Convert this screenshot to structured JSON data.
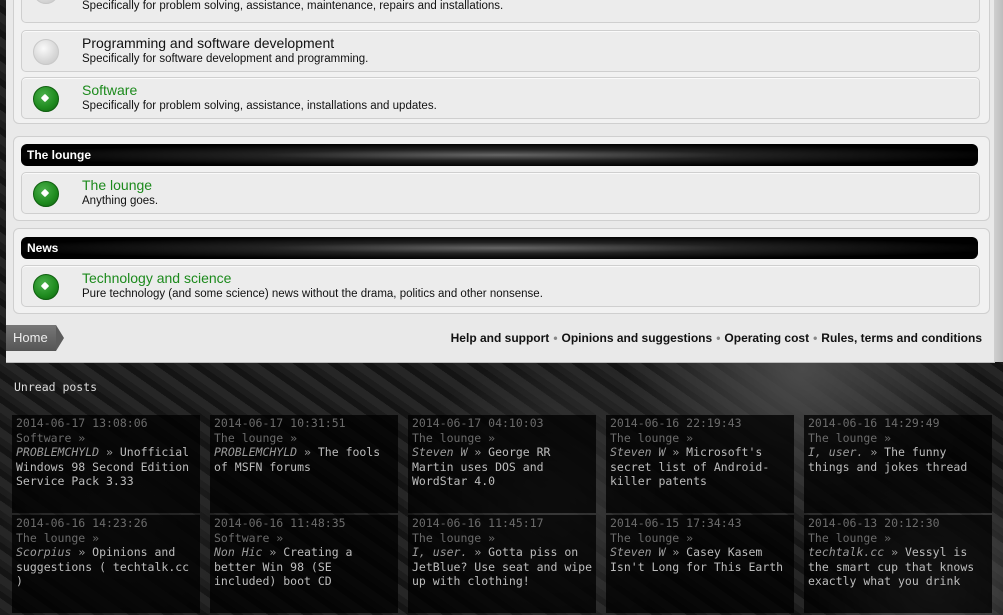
{
  "categories": {
    "support_forums": [
      {
        "name": "",
        "desc": "Specifically for problem solving, assistance, maintenance, repairs and installations.",
        "unread": false
      },
      {
        "name": "Programming and software development",
        "desc": "Specifically for software development and programming.",
        "unread": false
      },
      {
        "name": "Software",
        "desc": "Specifically for problem solving, assistance, installations and updates.",
        "unread": true
      }
    ],
    "lounge": {
      "title": "The lounge",
      "forums": [
        {
          "name": "The lounge",
          "desc": "Anything goes.",
          "unread": true
        }
      ]
    },
    "news": {
      "title": "News",
      "forums": [
        {
          "name": "Technology and science",
          "desc": "Pure technology (and some science) news without the drama, politics and other nonsense.",
          "unread": true
        }
      ]
    }
  },
  "breadcrumb": {
    "home": "Home"
  },
  "footer_links": [
    "Help and support",
    "Opinions and suggestions",
    "Operating cost",
    "Rules, terms and conditions"
  ],
  "unread": {
    "title": "Unread posts",
    "posts": [
      {
        "date": "2014-06-17 13:08:06",
        "forum": "Software »",
        "author": "PROBLEMCHYLD",
        "title": "Unofficial Windows 98 Second Edition Service Pack 3.33"
      },
      {
        "date": "2014-06-17 10:31:51",
        "forum": "The lounge »",
        "author": "PROBLEMCHYLD",
        "title": "The fools of MSFN forums"
      },
      {
        "date": "2014-06-17 04:10:03",
        "forum": "The lounge »",
        "author": "Steven W",
        "title": "George RR Martin uses DOS and WordStar 4.0"
      },
      {
        "date": "2014-06-16 22:19:43",
        "forum": "The lounge »",
        "author": "Steven W",
        "title": "Microsoft's secret list of Android-killer patents"
      },
      {
        "date": "2014-06-16 14:29:49",
        "forum": "The lounge »",
        "author": "I, user.",
        "title": "The funny things and jokes thread"
      },
      {
        "date": "2014-06-16 14:23:26",
        "forum": "The lounge »",
        "author": "Scorpius",
        "title": "Opinions and suggestions ( techtalk.cc )"
      },
      {
        "date": "2014-06-16 11:48:35",
        "forum": "Software »",
        "author": "Non Hic",
        "title": "Creating a better Win 98 (SE included) boot CD"
      },
      {
        "date": "2014-06-16 11:45:17",
        "forum": "The lounge »",
        "author": "I, user.",
        "title": "Gotta piss on JetBlue? Use seat and wipe up with clothing!"
      },
      {
        "date": "2014-06-15 17:34:43",
        "forum": "The lounge »",
        "author": "Steven W",
        "title": "Casey Kasem Isn't Long for This Earth"
      },
      {
        "date": "2014-06-13 20:12:30",
        "forum": "The lounge »",
        "author": "techtalk.cc",
        "title": "Vessyl is the smart cup that knows exactly what you drink"
      }
    ]
  }
}
